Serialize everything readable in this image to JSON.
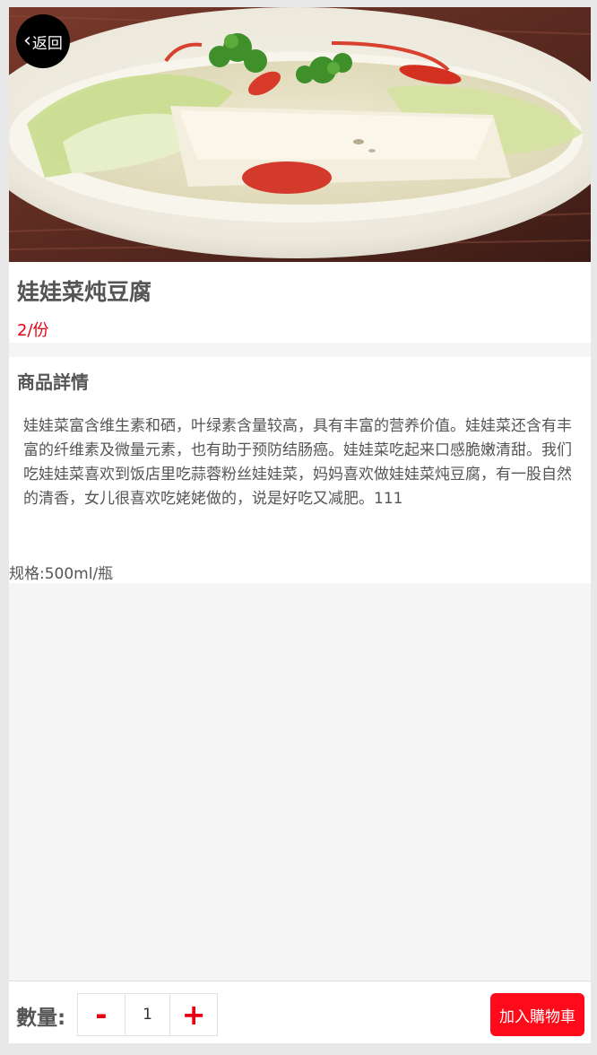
{
  "header": {
    "back_label": "返回",
    "back_icon": "chevron-left-icon"
  },
  "product": {
    "name": "娃娃菜炖豆腐",
    "price": "2/份"
  },
  "detail": {
    "heading": "商品詳情",
    "description": "娃娃菜富含维生素和硒，叶绿素含量较高，具有丰富的营养价值。娃娃菜还含有丰富的纤维素及微量元素，也有助于预防结肠癌。娃娃菜吃起来口感脆嫩清甜。我们吃娃娃菜喜欢到饭店里吃蒜蓉粉丝娃娃菜，妈妈喜欢做娃娃菜炖豆腐，有一股自然的清香，女儿很喜欢吃姥姥做的，说是好吃又减肥。111",
    "spec": "规格:500ml/瓶"
  },
  "cart": {
    "quantity_label": "數量:",
    "minus_label": "-",
    "quantity": "1",
    "plus_label": "+",
    "add_button": "加入購物車"
  },
  "colors": {
    "accent_red": "#e60012",
    "button_red": "#ff0a1a",
    "text_gray": "#555555",
    "background": "#f5f5f5"
  }
}
